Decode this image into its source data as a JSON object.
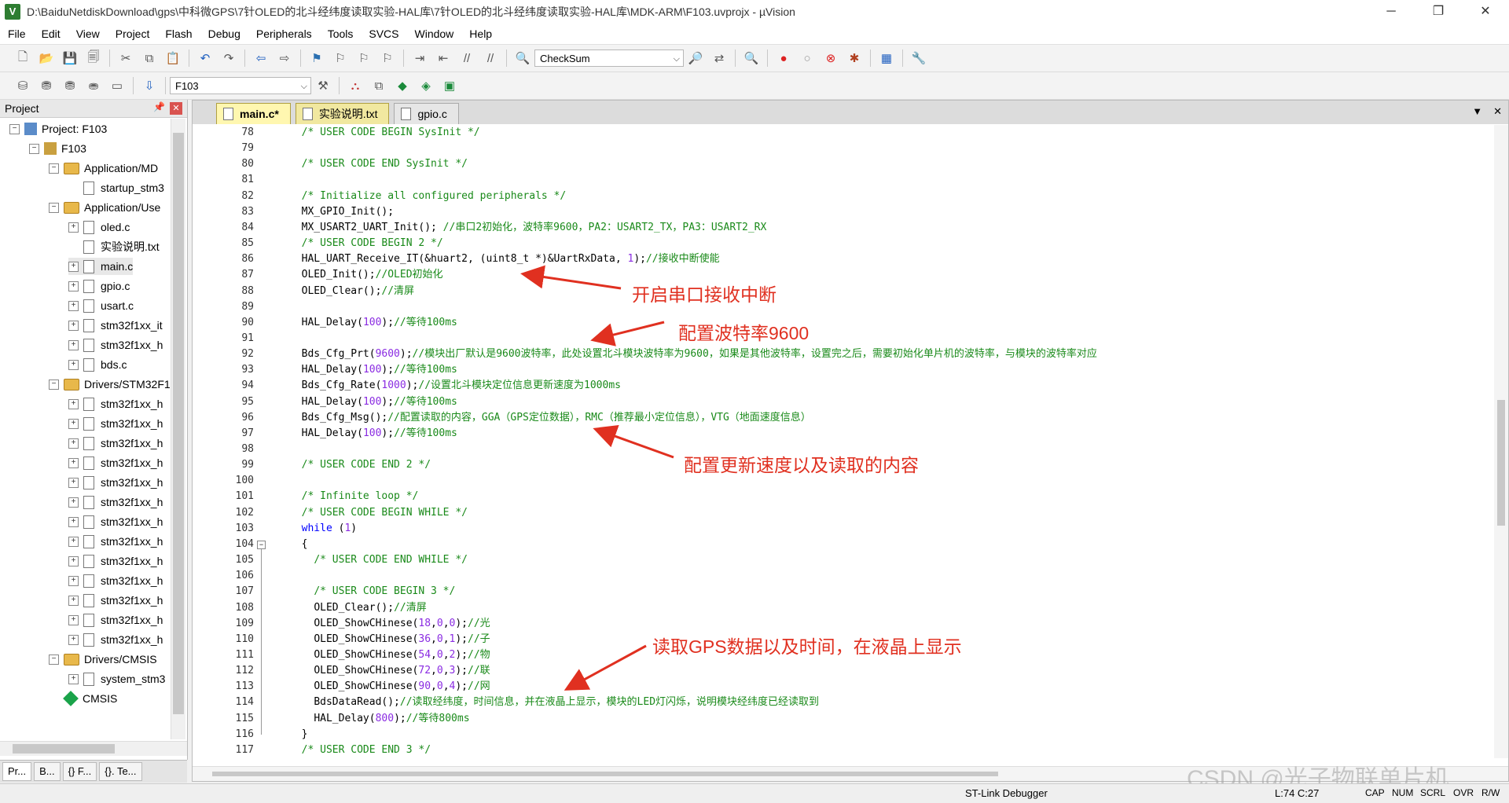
{
  "window": {
    "title": "D:\\BaiduNetdiskDownload\\gps\\中科微GPS\\7针OLED的北斗经纬度读取实验-HAL库\\7针OLED的北斗经纬度读取实验-HAL库\\MDK-ARM\\F103.uvprojx - µVision",
    "icon": "uvision-icon",
    "controls": [
      "─",
      "❐",
      "✕"
    ]
  },
  "menu": [
    "File",
    "Edit",
    "View",
    "Project",
    "Flash",
    "Debug",
    "Peripherals",
    "Tools",
    "SVCS",
    "Window",
    "Help"
  ],
  "toolbar": {
    "find_combo": "CheckSum",
    "target_combo": "F103"
  },
  "sidebar": {
    "title": "Project",
    "tree": [
      {
        "label": "Project: F103",
        "level": 0,
        "type": "project",
        "exp": "⊟"
      },
      {
        "label": "F103",
        "level": 1,
        "type": "target",
        "exp": "⊟"
      },
      {
        "label": "Application/MD",
        "level": 2,
        "type": "folder",
        "exp": "⊟"
      },
      {
        "label": "startup_stm3",
        "level": 3,
        "type": "file",
        "exp": ""
      },
      {
        "label": "Application/Use",
        "level": 2,
        "type": "folder",
        "exp": "⊟"
      },
      {
        "label": "oled.c",
        "level": 3,
        "type": "file",
        "exp": "⊞"
      },
      {
        "label": "实验说明.txt",
        "level": 3,
        "type": "file",
        "exp": ""
      },
      {
        "label": "main.c",
        "level": 3,
        "type": "file",
        "exp": "⊞"
      },
      {
        "label": "gpio.c",
        "level": 3,
        "type": "file",
        "exp": "⊞"
      },
      {
        "label": "usart.c",
        "level": 3,
        "type": "file",
        "exp": "⊞"
      },
      {
        "label": "stm32f1xx_it",
        "level": 3,
        "type": "file",
        "exp": "⊞"
      },
      {
        "label": "stm32f1xx_h",
        "level": 3,
        "type": "file",
        "exp": "⊞"
      },
      {
        "label": "bds.c",
        "level": 3,
        "type": "file",
        "exp": "⊞"
      },
      {
        "label": "Drivers/STM32F1",
        "level": 2,
        "type": "folder",
        "exp": "⊟"
      },
      {
        "label": "stm32f1xx_h",
        "level": 3,
        "type": "file",
        "exp": "⊞"
      },
      {
        "label": "stm32f1xx_h",
        "level": 3,
        "type": "file",
        "exp": "⊞"
      },
      {
        "label": "stm32f1xx_h",
        "level": 3,
        "type": "file",
        "exp": "⊞"
      },
      {
        "label": "stm32f1xx_h",
        "level": 3,
        "type": "file",
        "exp": "⊞"
      },
      {
        "label": "stm32f1xx_h",
        "level": 3,
        "type": "file",
        "exp": "⊞"
      },
      {
        "label": "stm32f1xx_h",
        "level": 3,
        "type": "file",
        "exp": "⊞"
      },
      {
        "label": "stm32f1xx_h",
        "level": 3,
        "type": "file",
        "exp": "⊞"
      },
      {
        "label": "stm32f1xx_h",
        "level": 3,
        "type": "file",
        "exp": "⊞"
      },
      {
        "label": "stm32f1xx_h",
        "level": 3,
        "type": "file",
        "exp": "⊞"
      },
      {
        "label": "stm32f1xx_h",
        "level": 3,
        "type": "file",
        "exp": "⊞"
      },
      {
        "label": "stm32f1xx_h",
        "level": 3,
        "type": "file",
        "exp": "⊞"
      },
      {
        "label": "stm32f1xx_h",
        "level": 3,
        "type": "file",
        "exp": "⊞"
      },
      {
        "label": "stm32f1xx_h",
        "level": 3,
        "type": "file",
        "exp": "⊞"
      },
      {
        "label": "Drivers/CMSIS",
        "level": 2,
        "type": "folder",
        "exp": "⊟"
      },
      {
        "label": "system_stm3",
        "level": 3,
        "type": "file",
        "exp": "⊞"
      },
      {
        "label": "CMSIS",
        "level": 2,
        "type": "cmsis",
        "exp": ""
      }
    ],
    "tabs": [
      "Pr...",
      "B...",
      "{} F...",
      "{}. Te..."
    ]
  },
  "editor": {
    "tabs": [
      {
        "label": "main.c*",
        "active": true
      },
      {
        "label": "实验说明.txt",
        "active": false
      },
      {
        "label": "gpio.c",
        "active": false
      }
    ],
    "lines": [
      {
        "n": "78",
        "indent": "  ",
        "segs": [
          [
            "cm",
            "/* USER CODE BEGIN SysInit */"
          ]
        ]
      },
      {
        "n": "79",
        "indent": "",
        "segs": []
      },
      {
        "n": "80",
        "indent": "  ",
        "segs": [
          [
            "cm",
            "/* USER CODE END SysInit */"
          ]
        ]
      },
      {
        "n": "81",
        "indent": "",
        "segs": []
      },
      {
        "n": "82",
        "indent": "  ",
        "segs": [
          [
            "cm",
            "/* Initialize all configured peripherals */"
          ]
        ]
      },
      {
        "n": "83",
        "indent": "  ",
        "segs": [
          [
            "",
            "MX_GPIO_Init();"
          ]
        ]
      },
      {
        "n": "84",
        "indent": "  ",
        "segs": [
          [
            "",
            "MX_USART2_UART_Init(); "
          ],
          [
            "cm",
            "//串口2初始化，波特率9600，PA2：USART2_TX，PA3：USART2_RX"
          ]
        ]
      },
      {
        "n": "85",
        "indent": "  ",
        "segs": [
          [
            "cm",
            "/* USER CODE BEGIN 2 */"
          ]
        ]
      },
      {
        "n": "86",
        "indent": "  ",
        "segs": [
          [
            "",
            "HAL_UART_Receive_IT(&huart2, (uint8_t *)&UartRxData, "
          ],
          [
            "nm",
            "1"
          ],
          [
            "",
            ");"
          ],
          [
            "cm",
            "//接收中断使能"
          ]
        ]
      },
      {
        "n": "87",
        "indent": "  ",
        "segs": [
          [
            "",
            "OLED_Init();"
          ],
          [
            "cm",
            "//OLED初始化"
          ]
        ]
      },
      {
        "n": "88",
        "indent": "  ",
        "segs": [
          [
            "",
            "OLED_Clear();"
          ],
          [
            "cm",
            "//清屏"
          ]
        ]
      },
      {
        "n": "89",
        "indent": "",
        "segs": []
      },
      {
        "n": "90",
        "indent": "  ",
        "segs": [
          [
            "",
            "HAL_Delay("
          ],
          [
            "nm",
            "100"
          ],
          [
            "",
            ");"
          ],
          [
            "cm",
            "//等待100ms"
          ]
        ]
      },
      {
        "n": "91",
        "indent": "",
        "segs": []
      },
      {
        "n": "92",
        "indent": "  ",
        "segs": [
          [
            "",
            "Bds_Cfg_Prt("
          ],
          [
            "nm",
            "9600"
          ],
          [
            "",
            ");"
          ],
          [
            "cm",
            "//模块出厂默认是9600波特率，此处设置北斗模块波特率为9600，如果是其他波特率，设置完之后，需要初始化单片机的波特率，与模块的波特率对应"
          ]
        ]
      },
      {
        "n": "93",
        "indent": "  ",
        "segs": [
          [
            "",
            "HAL_Delay("
          ],
          [
            "nm",
            "100"
          ],
          [
            "",
            ");"
          ],
          [
            "cm",
            "//等待100ms"
          ]
        ]
      },
      {
        "n": "94",
        "indent": "  ",
        "segs": [
          [
            "",
            "Bds_Cfg_Rate("
          ],
          [
            "nm",
            "1000"
          ],
          [
            "",
            ");"
          ],
          [
            "cm",
            "//设置北斗模块定位信息更新速度为1000ms"
          ]
        ]
      },
      {
        "n": "95",
        "indent": "  ",
        "segs": [
          [
            "",
            "HAL_Delay("
          ],
          [
            "nm",
            "100"
          ],
          [
            "",
            ");"
          ],
          [
            "cm",
            "//等待100ms"
          ]
        ]
      },
      {
        "n": "96",
        "indent": "  ",
        "segs": [
          [
            "",
            "Bds_Cfg_Msg();"
          ],
          [
            "cm",
            "//配置读取的内容，GGA（GPS定位数据），RMC（推荐最小定位信息），VTG（地面速度信息）"
          ]
        ]
      },
      {
        "n": "97",
        "indent": "  ",
        "segs": [
          [
            "",
            "HAL_Delay("
          ],
          [
            "nm",
            "100"
          ],
          [
            "",
            ");"
          ],
          [
            "cm",
            "//等待100ms"
          ]
        ]
      },
      {
        "n": "98",
        "indent": "",
        "segs": []
      },
      {
        "n": "99",
        "indent": "  ",
        "segs": [
          [
            "cm",
            "/* USER CODE END 2 */"
          ]
        ]
      },
      {
        "n": "100",
        "indent": "",
        "segs": []
      },
      {
        "n": "101",
        "indent": "  ",
        "segs": [
          [
            "cm",
            "/* Infinite loop */"
          ]
        ]
      },
      {
        "n": "102",
        "indent": "  ",
        "segs": [
          [
            "cm",
            "/* USER CODE BEGIN WHILE */"
          ]
        ]
      },
      {
        "n": "103",
        "indent": "  ",
        "segs": [
          [
            "kw",
            "while"
          ],
          [
            "",
            " ("
          ],
          [
            "nm",
            "1"
          ],
          [
            "",
            ")"
          ]
        ]
      },
      {
        "n": "104",
        "indent": "  ",
        "segs": [
          [
            "",
            "{"
          ]
        ]
      },
      {
        "n": "105",
        "indent": "    ",
        "segs": [
          [
            "cm",
            "/* USER CODE END WHILE */"
          ]
        ]
      },
      {
        "n": "106",
        "indent": "",
        "segs": []
      },
      {
        "n": "107",
        "indent": "    ",
        "segs": [
          [
            "cm",
            "/* USER CODE BEGIN 3 */"
          ]
        ]
      },
      {
        "n": "108",
        "indent": "    ",
        "segs": [
          [
            "",
            "OLED_Clear();"
          ],
          [
            "cm",
            "//清屏"
          ]
        ]
      },
      {
        "n": "109",
        "indent": "    ",
        "segs": [
          [
            "",
            "OLED_ShowCHinese("
          ],
          [
            "nm",
            "18"
          ],
          [
            "",
            ","
          ],
          [
            "nm",
            "0"
          ],
          [
            "",
            ","
          ],
          [
            "nm",
            "0"
          ],
          [
            "",
            ");"
          ],
          [
            "cm",
            "//光"
          ]
        ]
      },
      {
        "n": "110",
        "indent": "    ",
        "segs": [
          [
            "",
            "OLED_ShowCHinese("
          ],
          [
            "nm",
            "36"
          ],
          [
            "",
            ","
          ],
          [
            "nm",
            "0"
          ],
          [
            "",
            ","
          ],
          [
            "nm",
            "1"
          ],
          [
            "",
            ");"
          ],
          [
            "cm",
            "//子"
          ]
        ]
      },
      {
        "n": "111",
        "indent": "    ",
        "segs": [
          [
            "",
            "OLED_ShowCHinese("
          ],
          [
            "nm",
            "54"
          ],
          [
            "",
            ","
          ],
          [
            "nm",
            "0"
          ],
          [
            "",
            ","
          ],
          [
            "nm",
            "2"
          ],
          [
            "",
            ");"
          ],
          [
            "cm",
            "//物"
          ]
        ]
      },
      {
        "n": "112",
        "indent": "    ",
        "segs": [
          [
            "",
            "OLED_ShowCHinese("
          ],
          [
            "nm",
            "72"
          ],
          [
            "",
            ","
          ],
          [
            "nm",
            "0"
          ],
          [
            "",
            ","
          ],
          [
            "nm",
            "3"
          ],
          [
            "",
            ");"
          ],
          [
            "cm",
            "//联"
          ]
        ]
      },
      {
        "n": "113",
        "indent": "    ",
        "segs": [
          [
            "",
            "OLED_ShowCHinese("
          ],
          [
            "nm",
            "90"
          ],
          [
            "",
            ","
          ],
          [
            "nm",
            "0"
          ],
          [
            "",
            ","
          ],
          [
            "nm",
            "4"
          ],
          [
            "",
            ");"
          ],
          [
            "cm",
            "//网"
          ]
        ]
      },
      {
        "n": "114",
        "indent": "    ",
        "segs": [
          [
            "",
            "BdsDataRead();"
          ],
          [
            "cm",
            "//读取经纬度，时间信息，并在液晶上显示，模块的LED灯闪烁，说明模块经纬度已经读取到"
          ]
        ]
      },
      {
        "n": "115",
        "indent": "    ",
        "segs": [
          [
            "",
            "HAL_Delay("
          ],
          [
            "nm",
            "800"
          ],
          [
            "",
            ");"
          ],
          [
            "cm",
            "//等待800ms"
          ]
        ]
      },
      {
        "n": "116",
        "indent": "  ",
        "segs": [
          [
            "",
            "}"
          ]
        ]
      },
      {
        "n": "117",
        "indent": "  ",
        "segs": [
          [
            "cm",
            "/* USER CODE END 3 */"
          ]
        ]
      }
    ]
  },
  "annotations": [
    "开启串口接收中断",
    "配置波特率9600",
    "配置更新速度以及读取的内容",
    "读取GPS数据以及时间，在液晶上显示"
  ],
  "annotation_color": "#e03020",
  "status": {
    "debugger": "ST-Link Debugger",
    "position": "L:74 C:27",
    "indicators": [
      "CAP",
      "NUM",
      "SCRL",
      "OVR",
      "R/W"
    ]
  },
  "watermark": "CSDN @光子物联单片机"
}
